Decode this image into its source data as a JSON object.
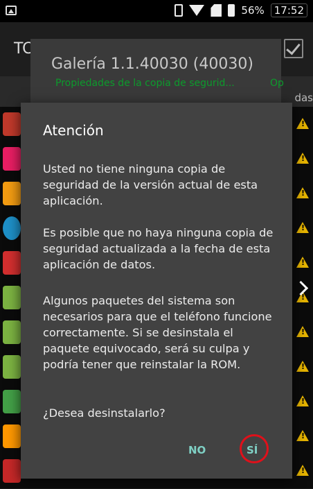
{
  "status_bar": {
    "battery": "56%",
    "time": "17:52",
    "icons": [
      "image-icon",
      "vibrate-icon",
      "wifi-icon",
      "no-sim-icon",
      "battery-icon"
    ]
  },
  "app": {
    "title": "TC",
    "tabs_label": "das"
  },
  "properties_panel": {
    "title": "Galería 1.1.40030 (40030)",
    "subtitle": "Propiedades de la copia de segurid...",
    "subtitle2": "Op"
  },
  "dialog": {
    "title": "Atención",
    "paragraphs": [
      "Usted no tiene ninguna copia de seguridad de la versión actual de esta aplicación.",
      "Es posible que no haya ninguna copia de seguridad actualizada a la fecha de esta aplicación de datos.",
      "Algunos paquetes del sistema son necesarios para que el teléfono funcione correctamente. Si se desinstala el paquete equivocado, será su culpa y podría tener que reinstalar la ROM.",
      "¿Desea desinstalarlo?"
    ],
    "buttons": {
      "no": "NO",
      "yes": "SÍ"
    }
  },
  "colors": {
    "dialog_bg": "#424242",
    "button_text": "#7fd0c4",
    "highlight_ring": "#e0101a",
    "panel_subtitle": "#0c9b2c",
    "warning": "#e6b400"
  }
}
